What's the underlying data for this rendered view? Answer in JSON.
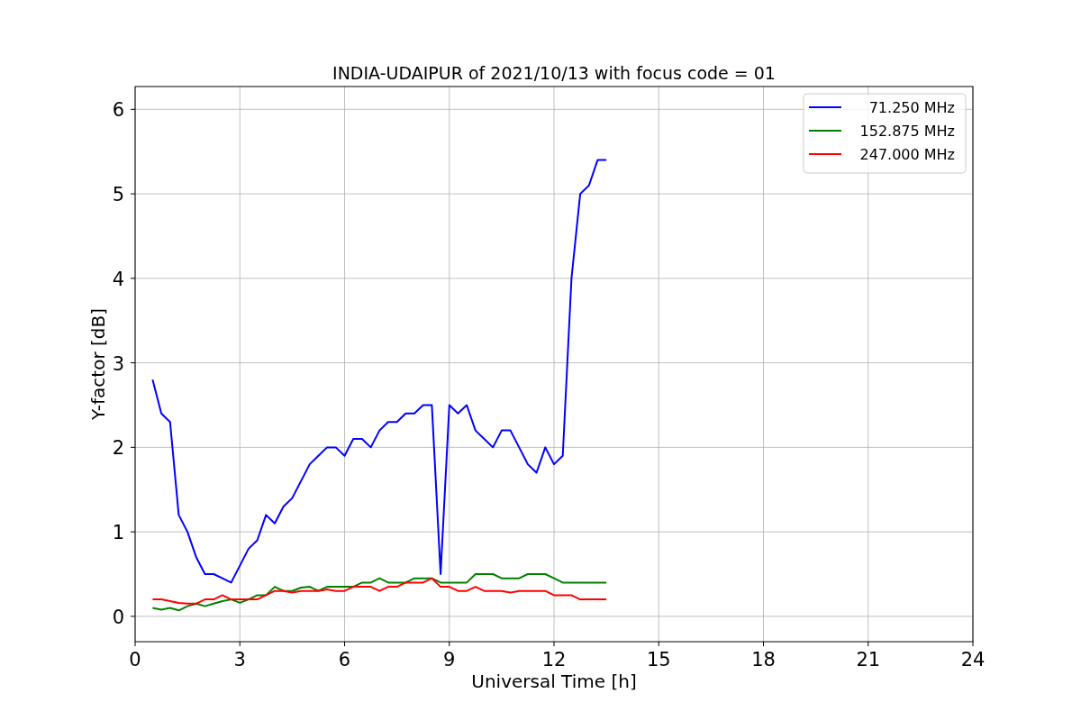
{
  "chart_data": {
    "type": "line",
    "title": "INDIA-UDAIPUR of 2021/10/13 with focus code = 01",
    "xlabel": "Universal Time [h]",
    "ylabel": "Y-factor [dB]",
    "x": [
      0.5,
      0.75,
      1.0,
      1.25,
      1.5,
      1.75,
      2.0,
      2.25,
      2.5,
      2.75,
      3.0,
      3.25,
      3.5,
      3.75,
      4.0,
      4.25,
      4.5,
      4.75,
      5.0,
      5.25,
      5.5,
      5.75,
      6.0,
      6.25,
      6.5,
      6.75,
      7.0,
      7.25,
      7.5,
      7.75,
      8.0,
      8.25,
      8.5,
      8.75,
      9.0,
      9.25,
      9.5,
      9.75,
      10.0,
      10.25,
      10.5,
      10.75,
      11.0,
      11.25,
      11.5,
      11.75,
      12.0,
      12.25,
      12.5,
      12.75,
      13.0,
      13.25,
      13.5
    ],
    "series": [
      {
        "name": "71.250 MHz",
        "color": "#0000ff",
        "values": [
          2.8,
          2.4,
          2.3,
          1.2,
          1.0,
          0.7,
          0.5,
          0.5,
          0.45,
          0.4,
          0.6,
          0.8,
          0.9,
          1.2,
          1.1,
          1.3,
          1.4,
          1.6,
          1.8,
          1.9,
          2.0,
          2.0,
          1.9,
          2.1,
          2.1,
          2.0,
          2.2,
          2.3,
          2.3,
          2.4,
          2.4,
          2.5,
          2.5,
          0.5,
          2.5,
          2.4,
          2.5,
          2.2,
          2.1,
          2.0,
          2.2,
          2.2,
          2.0,
          1.8,
          1.7,
          2.0,
          1.8,
          1.9,
          4.0,
          5.0,
          5.1,
          5.4,
          5.4
        ]
      },
      {
        "name": "152.875 MHz",
        "color": "#008000",
        "values": [
          0.1,
          0.08,
          0.1,
          0.07,
          0.12,
          0.15,
          0.12,
          0.15,
          0.18,
          0.2,
          0.16,
          0.2,
          0.25,
          0.25,
          0.35,
          0.3,
          0.3,
          0.34,
          0.35,
          0.3,
          0.35,
          0.35,
          0.35,
          0.35,
          0.4,
          0.4,
          0.45,
          0.4,
          0.4,
          0.4,
          0.45,
          0.45,
          0.45,
          0.4,
          0.4,
          0.4,
          0.4,
          0.5,
          0.5,
          0.5,
          0.45,
          0.45,
          0.45,
          0.5,
          0.5,
          0.5,
          0.45,
          0.4,
          0.4,
          0.4,
          0.4,
          0.4,
          0.4
        ]
      },
      {
        "name": "247.000 MHz",
        "color": "#ff0000",
        "values": [
          0.2,
          0.2,
          0.18,
          0.16,
          0.15,
          0.15,
          0.2,
          0.2,
          0.25,
          0.2,
          0.2,
          0.2,
          0.2,
          0.25,
          0.3,
          0.3,
          0.28,
          0.3,
          0.3,
          0.3,
          0.32,
          0.3,
          0.3,
          0.35,
          0.35,
          0.35,
          0.3,
          0.35,
          0.35,
          0.4,
          0.4,
          0.4,
          0.45,
          0.35,
          0.35,
          0.3,
          0.3,
          0.35,
          0.3,
          0.3,
          0.3,
          0.28,
          0.3,
          0.3,
          0.3,
          0.3,
          0.25,
          0.25,
          0.25,
          0.2,
          0.2,
          0.2,
          0.2
        ]
      }
    ],
    "xlim": [
      0,
      24
    ],
    "ylim": [
      -0.3,
      6.27
    ],
    "xticks": [
      0,
      3,
      6,
      9,
      12,
      15,
      18,
      21,
      24
    ],
    "yticks": [
      0,
      1,
      2,
      3,
      4,
      5,
      6
    ],
    "grid": true,
    "legend": "upper right"
  }
}
